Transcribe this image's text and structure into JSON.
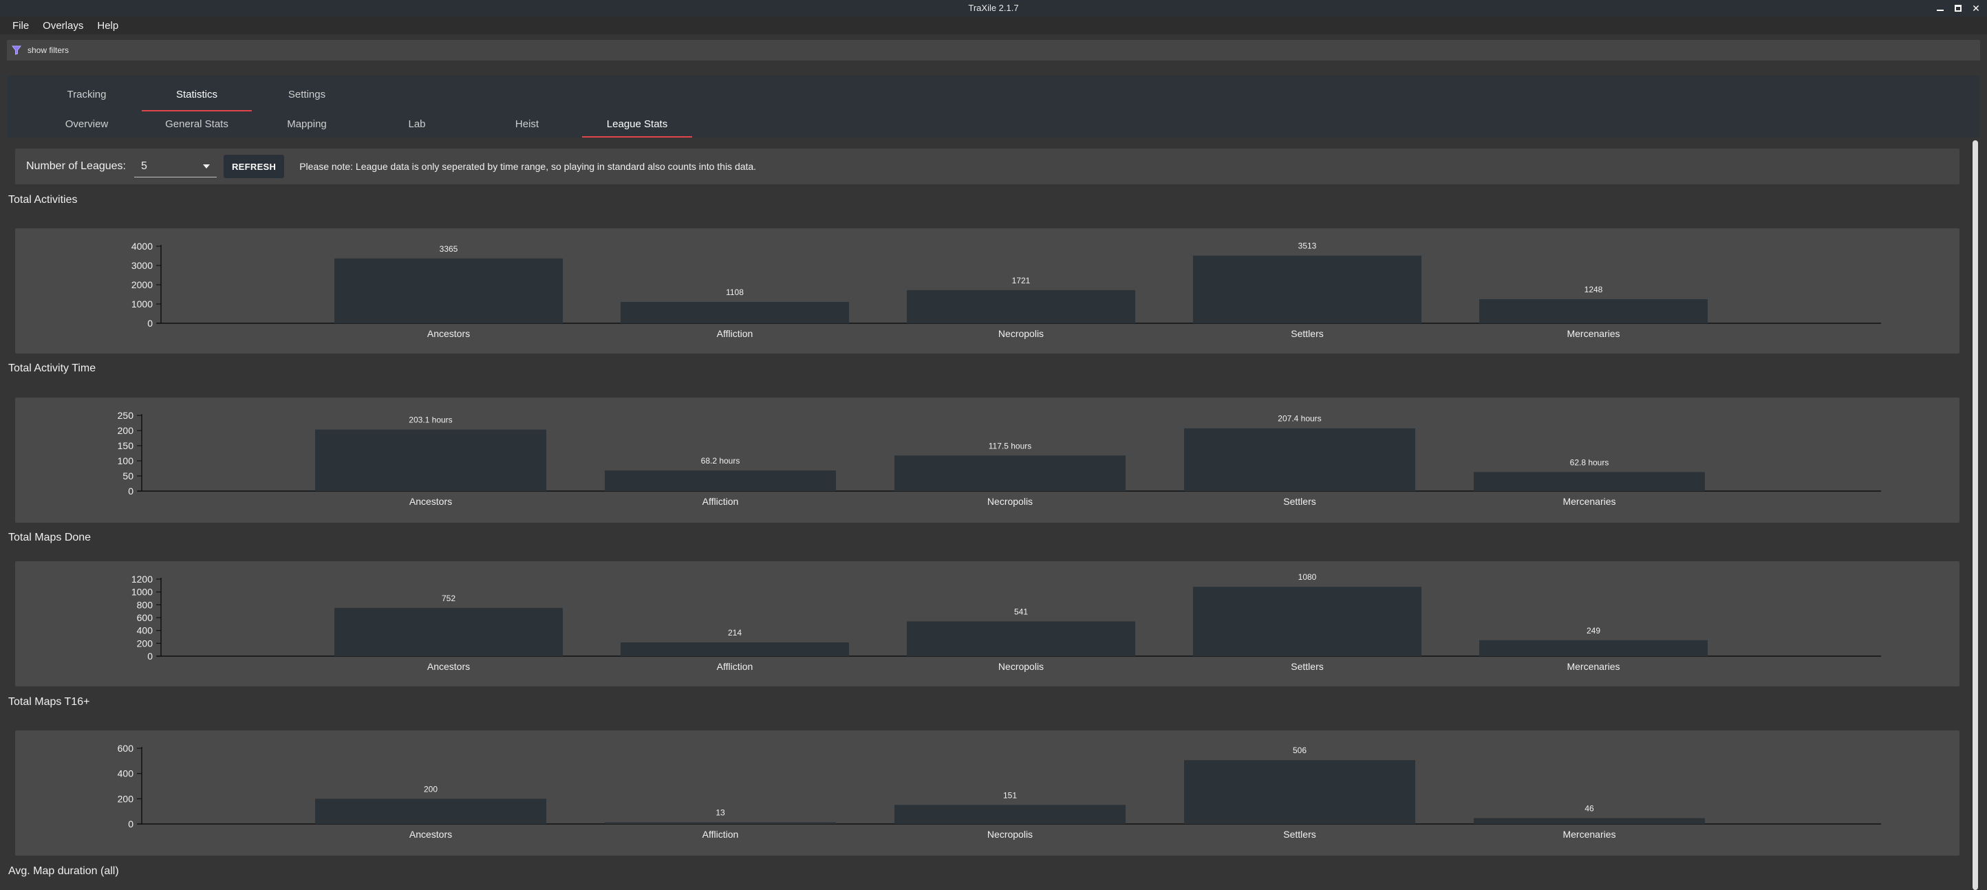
{
  "window": {
    "title": "TraXile 2.1.7",
    "controls": {
      "minimize": "minimize-icon",
      "maximize": "maximize-icon",
      "close": "✕"
    }
  },
  "menu": [
    "File",
    "Overlays",
    "Help"
  ],
  "filter_toggle": {
    "label": "show filters",
    "icon": "filter-icon"
  },
  "main_tabs": [
    {
      "label": "Tracking",
      "active": false
    },
    {
      "label": "Statistics",
      "active": true
    },
    {
      "label": "Settings",
      "active": false
    }
  ],
  "sub_tabs": [
    {
      "label": "Overview",
      "active": false
    },
    {
      "label": "General Stats",
      "active": false
    },
    {
      "label": "Mapping",
      "active": false
    },
    {
      "label": "Lab",
      "active": false
    },
    {
      "label": "Heist",
      "active": false
    },
    {
      "label": "League Stats",
      "active": true
    }
  ],
  "controls": {
    "num_leagues_label": "Number of Leagues:",
    "num_leagues_value": "5",
    "refresh_label": "REFRESH",
    "note": "Please note: League data is only seperated by time range, so playing in standard also counts into this data."
  },
  "sections": [
    "Total Activities",
    "Total Activity Time",
    "Total Maps Done",
    "Total Maps T16+",
    "Avg. Map duration (all)"
  ],
  "colors": {
    "bar": "#2b3238",
    "card": "#4a4a4a",
    "background": "#353535",
    "accent": "#e0454a"
  },
  "chart_data": [
    {
      "type": "bar",
      "title": "Total Activities",
      "categories": [
        "Ancestors",
        "Affliction",
        "Necropolis",
        "Settlers",
        "Mercenaries"
      ],
      "values": [
        3365,
        1108,
        1721,
        3513,
        1248
      ],
      "labels": [
        "3365",
        "1108",
        "1721",
        "3513",
        "1248"
      ],
      "ylim": [
        0,
        4000
      ],
      "yticks": [
        0,
        1000,
        2000,
        3000,
        4000
      ]
    },
    {
      "type": "bar",
      "title": "Total Activity Time",
      "categories": [
        "Ancestors",
        "Affliction",
        "Necropolis",
        "Settlers",
        "Mercenaries"
      ],
      "values": [
        203.1,
        68.2,
        117.5,
        207.4,
        62.8
      ],
      "labels": [
        "203.1 hours",
        "68.2 hours",
        "117.5 hours",
        "207.4 hours",
        "62.8 hours"
      ],
      "ylim": [
        0,
        250
      ],
      "yticks": [
        0,
        50,
        100,
        150,
        200,
        250
      ]
    },
    {
      "type": "bar",
      "title": "Total Maps Done",
      "categories": [
        "Ancestors",
        "Affliction",
        "Necropolis",
        "Settlers",
        "Mercenaries"
      ],
      "values": [
        752,
        214,
        541,
        1080,
        249
      ],
      "labels": [
        "752",
        "214",
        "541",
        "1080",
        "249"
      ],
      "ylim": [
        0,
        1200
      ],
      "yticks": [
        0,
        200,
        400,
        600,
        800,
        1000,
        1200
      ]
    },
    {
      "type": "bar",
      "title": "Total Maps T16+",
      "categories": [
        "Ancestors",
        "Affliction",
        "Necropolis",
        "Settlers",
        "Mercenaries"
      ],
      "values": [
        200,
        13,
        151,
        506,
        46
      ],
      "labels": [
        "200",
        "13",
        "151",
        "506",
        "46"
      ],
      "ylim": [
        0,
        600
      ],
      "yticks": [
        0,
        200,
        400,
        600
      ]
    }
  ]
}
